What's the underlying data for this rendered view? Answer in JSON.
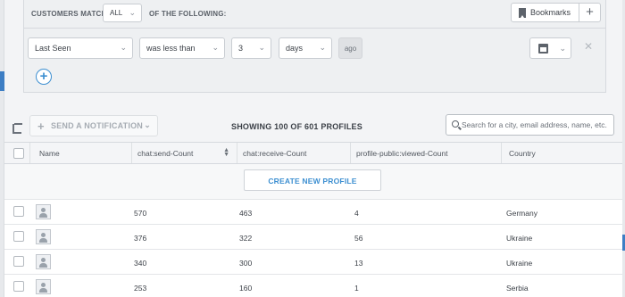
{
  "filter": {
    "match_prefix": "CUSTOMERS MATCH",
    "match_value": "ALL",
    "match_suffix": "OF THE FOLLOWING:",
    "bookmarks_label": "Bookmarks",
    "condition": {
      "property": "Last Seen",
      "operator": "was less than",
      "amount": "3",
      "unit": "days",
      "suffix": "ago"
    }
  },
  "toolbar": {
    "notify_label": "SEND A NOTIFICATION",
    "showing_text": "SHOWING 100 OF 601 PROFILES",
    "search_placeholder": "Search for a city, email address, name, etc."
  },
  "table": {
    "headers": {
      "name": "Name",
      "send": "chat:send-Count",
      "receive": "chat:receive-Count",
      "viewed": "profile-public:viewed-Count",
      "country": "Country"
    },
    "create_label": "CREATE NEW PROFILE",
    "rows": [
      {
        "send": "570",
        "receive": "463",
        "viewed": "4",
        "country": "Germany"
      },
      {
        "send": "376",
        "receive": "322",
        "viewed": "56",
        "country": "Ukraine"
      },
      {
        "send": "340",
        "receive": "300",
        "viewed": "13",
        "country": "Ukraine"
      },
      {
        "send": "253",
        "receive": "160",
        "viewed": "1",
        "country": "Serbia"
      }
    ]
  },
  "colors": {
    "accent": "#3d8fd1",
    "selected_strip": "#3d7ec4"
  }
}
